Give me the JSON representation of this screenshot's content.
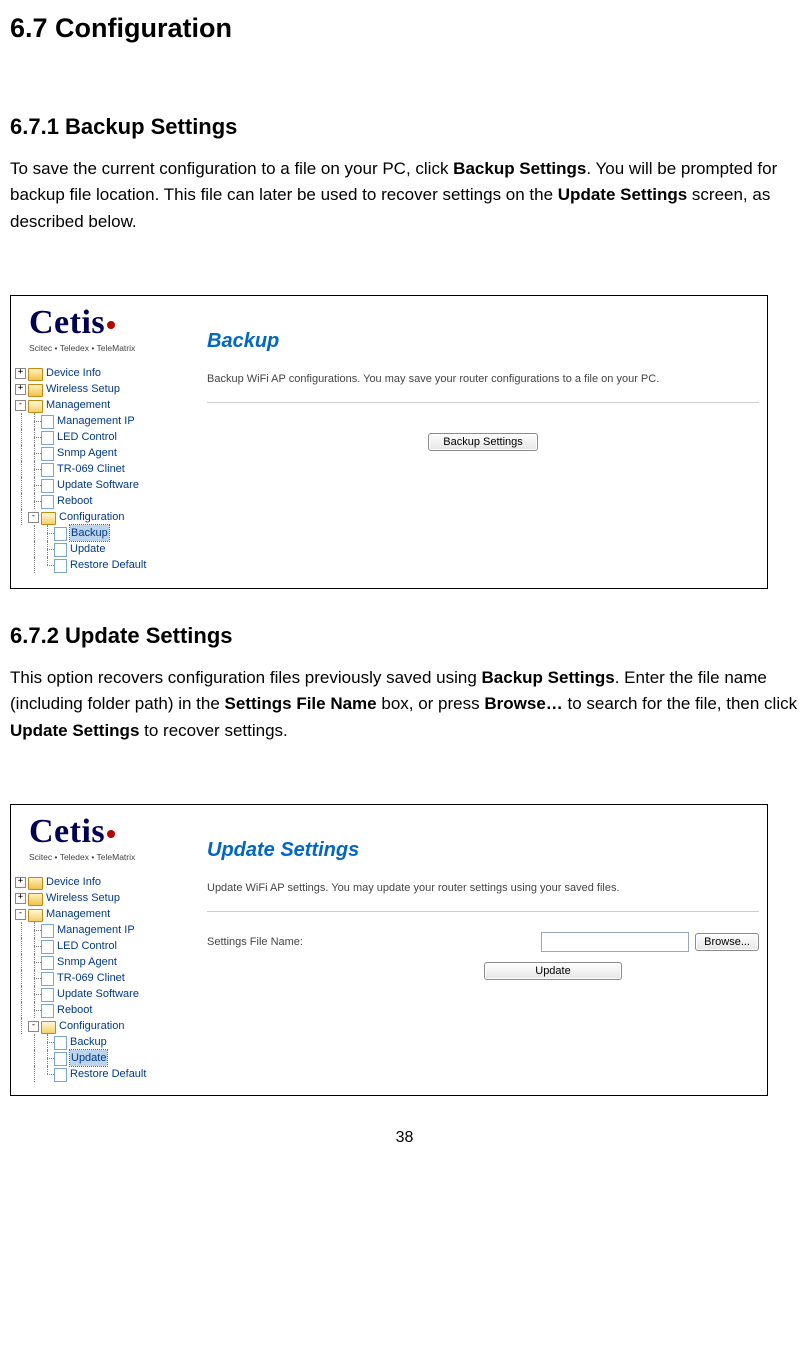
{
  "doc": {
    "h1": "6.7 Configuration",
    "h2a": "6.7.1  Backup Settings",
    "p1_pre": "To save the current configuration to a file on your PC, click ",
    "p1_b1": "Backup Settings",
    "p1_mid": ".  You will be prompted for backup file location. This file can later be used to recover settings on the ",
    "p1_b2": "Update Settings",
    "p1_post": " screen, as described below.",
    "h2b": "6.7.2  Update Settings",
    "p2_pre": "This option recovers configuration files previously saved using ",
    "p2_b1": "Backup Settings",
    "p2_m1": ".  Enter the file name (including folder path) in the ",
    "p2_b2": "Settings File Name",
    "p2_m2": " box, or press ",
    "p2_b3": "Browse…",
    "p2_m3": " to search for the file, then click ",
    "p2_b4": "Update Settings",
    "p2_post": " to recover settings.",
    "page_number": "38"
  },
  "logo": {
    "brand": "Cetis",
    "tagline": "Scitec • Teledex • TeleMatrix"
  },
  "tree": {
    "device_info": "Device Info",
    "wireless_setup": "Wireless Setup",
    "management": "Management",
    "management_ip": "Management IP",
    "led_control": "LED Control",
    "snmp_agent": "Snmp Agent",
    "tr069": "TR-069 Clinet",
    "update_software": "Update Software",
    "reboot": "Reboot",
    "configuration": "Configuration",
    "backup": "Backup",
    "update": "Update",
    "restore_default": "Restore Default"
  },
  "backup_panel": {
    "title": "Backup",
    "desc": "Backup WiFi AP configurations. You may save your router configurations to a file on your PC.",
    "button": "Backup Settings"
  },
  "update_panel": {
    "title": "Update Settings",
    "desc": "Update WiFi AP settings. You may update your router settings using your saved files.",
    "label": "Settings File Name:",
    "browse": "Browse...",
    "button": "Update"
  }
}
